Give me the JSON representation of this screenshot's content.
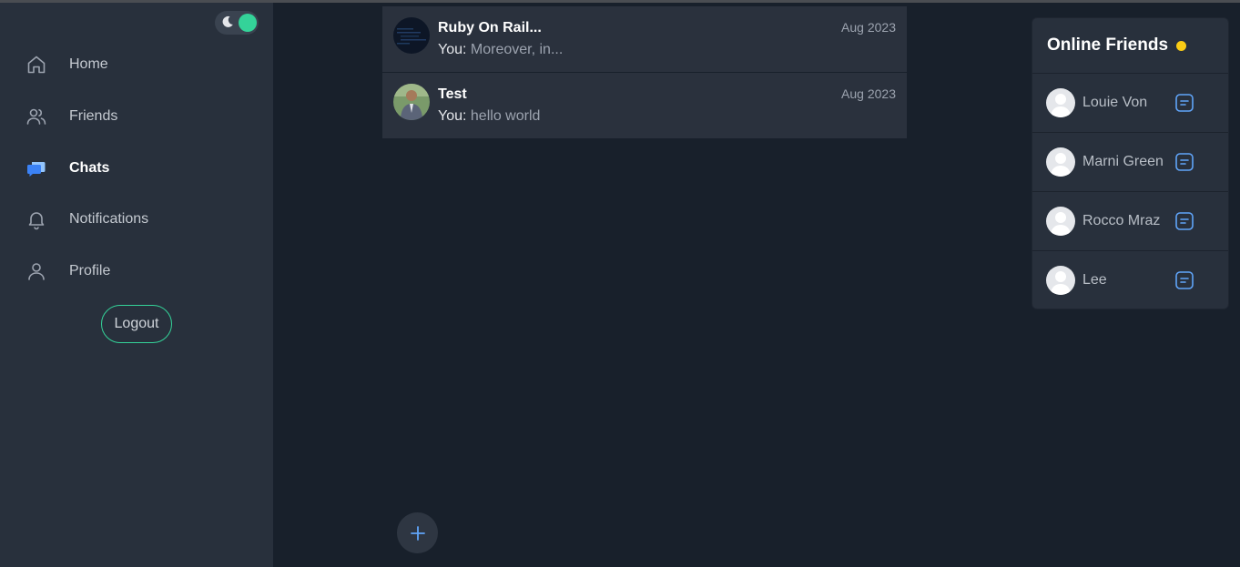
{
  "sidebar": {
    "nav": [
      {
        "label": "Home",
        "icon": "home-icon"
      },
      {
        "label": "Friends",
        "icon": "users-icon"
      },
      {
        "label": "Chats",
        "icon": "chat-bubbles-icon",
        "active": true
      },
      {
        "label": "Notifications",
        "icon": "bell-icon"
      },
      {
        "label": "Profile",
        "icon": "user-icon"
      }
    ],
    "logout_label": "Logout",
    "theme_toggle": {
      "mode": "dark"
    }
  },
  "chats": [
    {
      "name": "Ruby On Rail...",
      "prefix": "You:",
      "preview": "Moreover, in...",
      "date": "Aug 2023"
    },
    {
      "name": "Test",
      "prefix": "You:",
      "preview": "hello world",
      "date": "Aug 2023"
    }
  ],
  "online_friends": {
    "title": "Online Friends",
    "friends": [
      {
        "name": "Louie Von"
      },
      {
        "name": "Marni Green"
      },
      {
        "name": "Rocco Mraz"
      },
      {
        "name": "Lee"
      }
    ]
  },
  "colors": {
    "accent_green": "#34d399",
    "accent_blue": "#60a5fa",
    "online_yellow": "#facc15",
    "sidebar_bg": "#28303c",
    "main_bg": "#18202b"
  }
}
